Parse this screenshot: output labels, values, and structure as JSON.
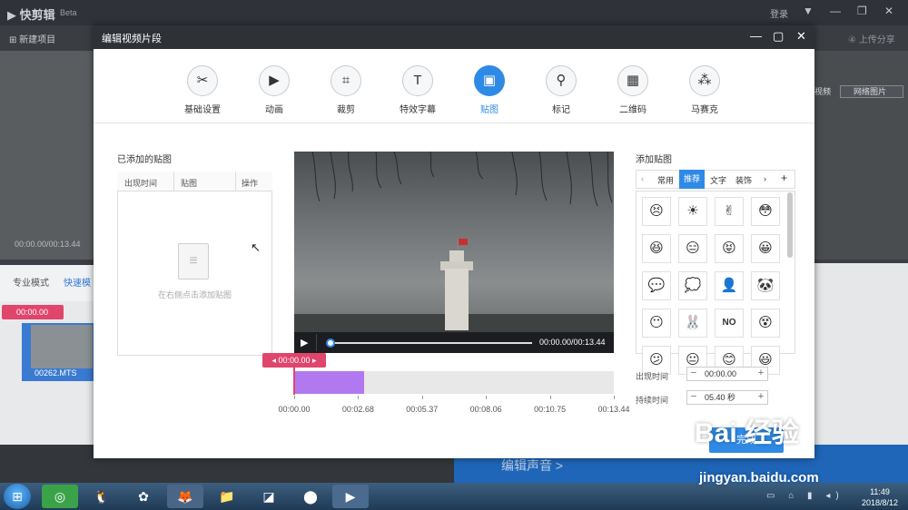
{
  "background": {
    "app_name": "快剪辑",
    "app_badge": "Beta",
    "login": "登录",
    "new_project": "新建项目",
    "upload_share": "上传分享",
    "preview_time": "00:00.00/00:13.44",
    "mode_pro": "专业模式",
    "mode_fast": "快速模",
    "timeline_marker": "00:00.00",
    "clip_name": "00262.MTS",
    "right_tab": "网络图片",
    "right_tab2": "视频",
    "edit_audio": "编辑声音 >"
  },
  "dialog": {
    "title": "编辑视频片段",
    "toolbar": [
      {
        "label": "基础设置",
        "icon": "scissors-icon",
        "glyph": "✂"
      },
      {
        "label": "动画",
        "icon": "animation-icon",
        "glyph": "▶"
      },
      {
        "label": "裁剪",
        "icon": "crop-icon",
        "glyph": "⌗"
      },
      {
        "label": "特效字幕",
        "icon": "text-icon",
        "glyph": "T"
      },
      {
        "label": "贴图",
        "icon": "image-icon",
        "glyph": "▣"
      },
      {
        "label": "标记",
        "icon": "pin-icon",
        "glyph": "⚲"
      },
      {
        "label": "二维码",
        "icon": "qrcode-icon",
        "glyph": "▦"
      },
      {
        "label": "马赛克",
        "icon": "mosaic-icon",
        "glyph": "⁂"
      }
    ],
    "active_tool": "贴图",
    "added_stickers": {
      "title": "已添加的贴图",
      "columns": [
        "出现时间",
        "贴图",
        "操作"
      ],
      "empty_text": "在右侧点击添加贴图"
    },
    "video": {
      "time": "00:00.00/00:13.44",
      "progress": 0
    },
    "timeline": {
      "marker": "00:00.00",
      "ticks": [
        "00:00.00",
        "00:02.68",
        "00:05.37",
        "00:08.06",
        "00:10.75",
        "00:13.44"
      ],
      "selection_fraction": 0.22
    },
    "add_sticker": {
      "title": "添加贴图",
      "tabs": [
        "常用",
        "推荐",
        "文字",
        "装饰"
      ],
      "active_tab": "推荐",
      "stickers": [
        "😣",
        "☀",
        "✌",
        "😳",
        "😆",
        "😑",
        "😝",
        "😀",
        "💬",
        "💭",
        "👤",
        "🐼",
        "😶",
        "🐰",
        "NO",
        "😵",
        "😕",
        "😐",
        "😊",
        "😃"
      ],
      "appear_label": "出现时间",
      "appear_value": "00:00.00",
      "duration_label": "持续时间",
      "duration_value": "05.40 秒"
    },
    "done": "完成"
  },
  "taskbar": {
    "time": "11:49",
    "date": "2018/8/12"
  },
  "watermark": {
    "main": "Bai 经验",
    "url": "jingyan.baidu.com"
  },
  "colors": {
    "accent": "#2f8ae6",
    "marker": "#e0456c",
    "selection": "#b179f0"
  }
}
